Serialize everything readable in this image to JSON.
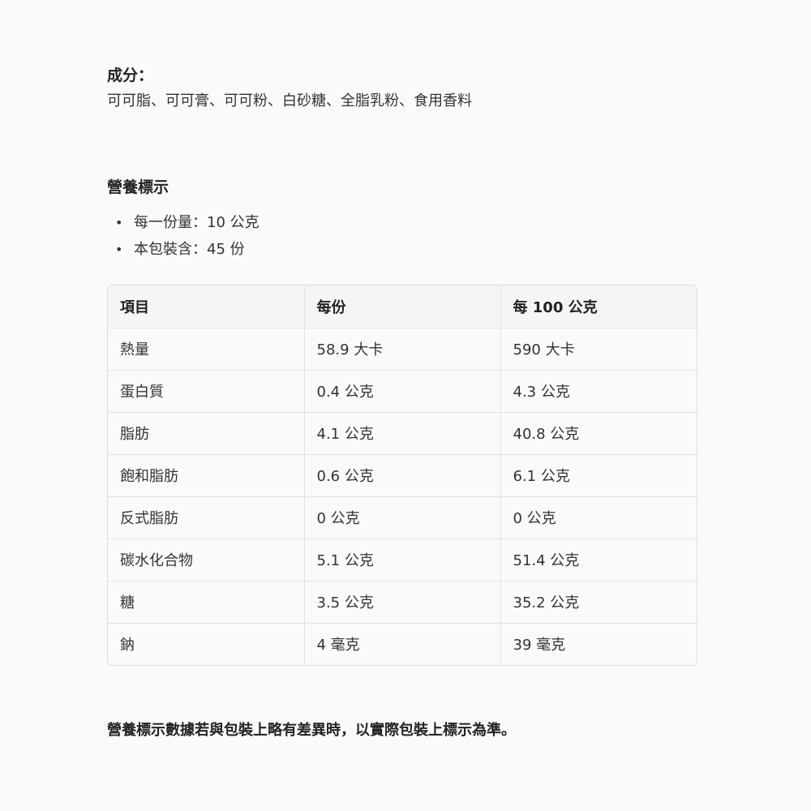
{
  "ingredients": {
    "title": "成分：",
    "text": "可可脂、可可膏、可可粉、白砂糖、全脂乳粉、食用香料"
  },
  "nutrition": {
    "title": "營養標示",
    "bullets": [
      "每一份量：10 公克",
      "本包裝含：45 份"
    ],
    "bullet_symbol": "•",
    "table": {
      "headers": [
        "項目",
        "每份",
        "每 100 公克"
      ],
      "rows": [
        [
          "熱量",
          "58.9 大卡",
          "590 大卡"
        ],
        [
          "蛋白質",
          "0.4 公克",
          "4.3 公克"
        ],
        [
          "脂肪",
          "4.1 公克",
          "40.8 公克"
        ],
        [
          "飽和脂肪",
          "0.6 公克",
          "6.1 公克"
        ],
        [
          "反式脂肪",
          "0 公克",
          "0 公克"
        ],
        [
          "碳水化合物",
          "5.1 公克",
          "51.4 公克"
        ],
        [
          "糖",
          "3.5 公克",
          "35.2 公克"
        ],
        [
          "鈉",
          "4 毫克",
          "39 毫克"
        ]
      ]
    }
  },
  "note": "營養標示數據若與包裝上略有差異時，以實際包裝上標示為準。"
}
